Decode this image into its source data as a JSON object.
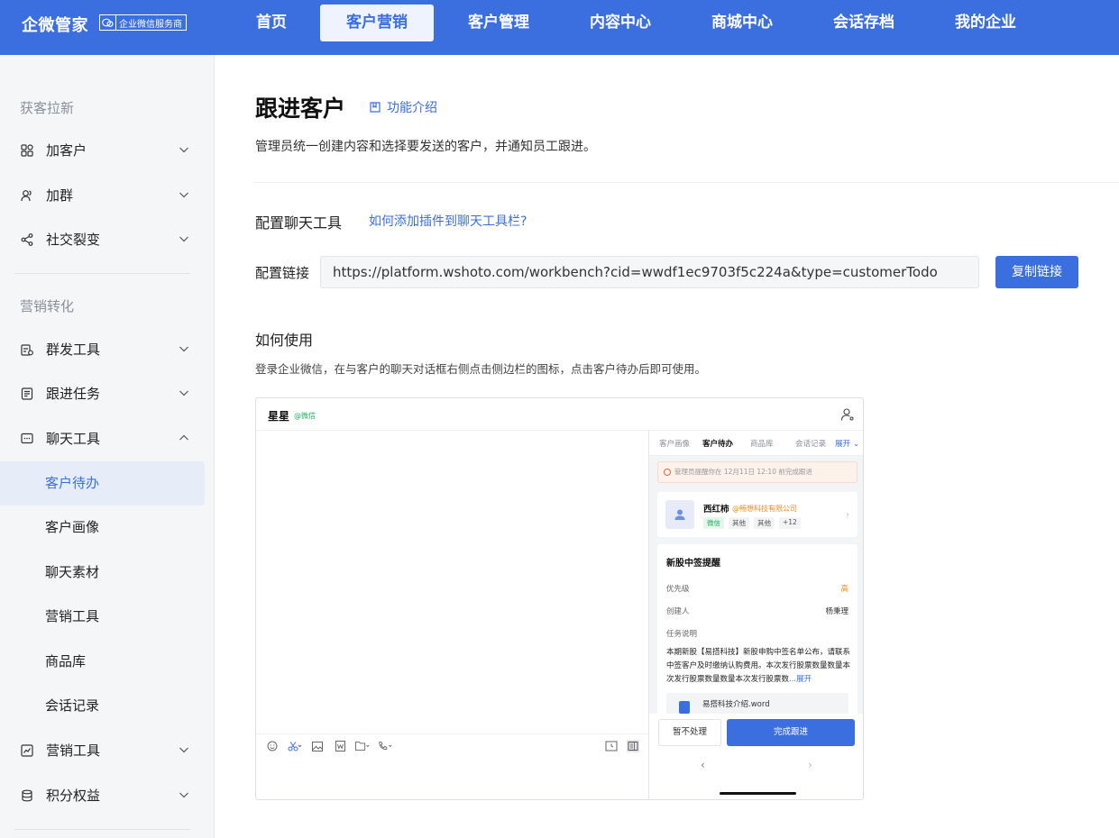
{
  "brand": {
    "name": "企微管家",
    "badge": "企业微信服务商"
  },
  "nav": [
    {
      "label": "首页"
    },
    {
      "label": "客户营销"
    },
    {
      "label": "客户管理"
    },
    {
      "label": "内容中心"
    },
    {
      "label": "商城中心"
    },
    {
      "label": "会话存档"
    },
    {
      "label": "我的企业"
    }
  ],
  "sidebar": {
    "group1": "获客拉新",
    "group2": "营销转化",
    "items": [
      {
        "label": "加客户",
        "icon": "apps-icon"
      },
      {
        "label": "加群",
        "icon": "users-icon"
      },
      {
        "label": "社交裂变",
        "icon": "share-icon"
      },
      {
        "label": "群发工具",
        "icon": "send-icon"
      },
      {
        "label": "跟进任务",
        "icon": "task-icon"
      },
      {
        "label": "聊天工具",
        "icon": "chat-icon"
      },
      {
        "label": "营销工具",
        "icon": "chart-icon"
      },
      {
        "label": "积分权益",
        "icon": "coins-icon"
      }
    ],
    "subitems": [
      {
        "label": "客户待办"
      },
      {
        "label": "客户画像"
      },
      {
        "label": "聊天素材"
      },
      {
        "label": "营销工具"
      },
      {
        "label": "商品库"
      },
      {
        "label": "会话记录"
      }
    ]
  },
  "main": {
    "title": "跟进客户",
    "intro_link": "功能介绍",
    "subtitle": "管理员统一创建内容和选择要发送的客户，并通知员工跟进。",
    "config_title": "配置聊天工具",
    "help_link": "如何添加插件到聊天工具栏?",
    "link_label": "配置链接",
    "link_value": "https://platform.wshoto.com/workbench?cid=wwdf1ec9703f5c224a&type=customerTodo",
    "copy_button": "复制链接",
    "howto_title": "如何使用",
    "howto_desc": "登录企业微信，在与客户的聊天对话框右侧点击侧边栏的图标，点击客户待办后即可使用。"
  },
  "preview": {
    "chat_name": "星星",
    "chat_source": "@微信",
    "tabs": [
      "客户画像",
      "客户待办",
      "商品库",
      "会话记录"
    ],
    "expand": "展开",
    "alert": "管理员提醒你在 12月11日 12:10 前完成跟进",
    "customer": {
      "name": "西红柿",
      "company": "@畅想科技有限公司",
      "tags": [
        "微信",
        "其他",
        "其他",
        "+12"
      ]
    },
    "task": {
      "title": "新股中签提醒",
      "priority_label": "优先级",
      "priority_value": "高",
      "creator_label": "创建人",
      "creator_value": "杨秉理",
      "desc_label": "任务说明",
      "desc": "本期新股【易搭科技】新股申购中签名单公布，请联系中签客户及时缴纳认购费用。本次发行股票数量数量本次发行股票数量数量本次发行股票数",
      "more": "...展开",
      "file": "易搭科技介绍.word"
    },
    "skip_button": "暂不处理",
    "done_button": "完成跟进"
  },
  "colors": {
    "primary": "#3b6fe0",
    "wechat_green": "#18b55a",
    "warning": "#f08b24"
  }
}
